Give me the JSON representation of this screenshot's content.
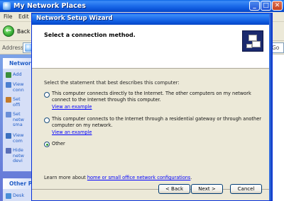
{
  "explorer": {
    "title": "My Network Places",
    "menu": [
      "File",
      "Edit"
    ],
    "back_label": "Back",
    "address_label": "Address",
    "go_label": "Go",
    "taskpane": {
      "network_tasks_title": "Network",
      "network_tasks": [
        "Add",
        "View\nconn",
        "Set\noffi",
        "Set\nnetw\nsma",
        "View\ncom",
        "Hide\nnetw\ndevi"
      ],
      "other_places_title": "Other P",
      "other_places": [
        "Desk"
      ]
    }
  },
  "wizard": {
    "title": "Network Setup Wizard",
    "heading": "Select a connection method.",
    "prompt": "Select the statement that best describes this computer:",
    "options": [
      {
        "text": "This computer connects directly to the Internet. The other computers on my network connect to the Internet through this computer.",
        "link": "View an example",
        "selected": false
      },
      {
        "text": "This computer connects to the Internet through a residential gateway or through another computer on my network.",
        "link": "View an example",
        "selected": false
      },
      {
        "text": "Other",
        "link": "",
        "selected": true
      }
    ],
    "learn_more_prefix": "Learn more about",
    "learn_more_link": "home or small office network configurations",
    "learn_more_suffix": ".",
    "buttons": {
      "back": "< Back",
      "next": "Next >",
      "cancel": "Cancel"
    }
  },
  "colors": {
    "xp_blue": "#0a54d8",
    "link": "#0000ff",
    "dialog_face": "#ece9d8"
  }
}
